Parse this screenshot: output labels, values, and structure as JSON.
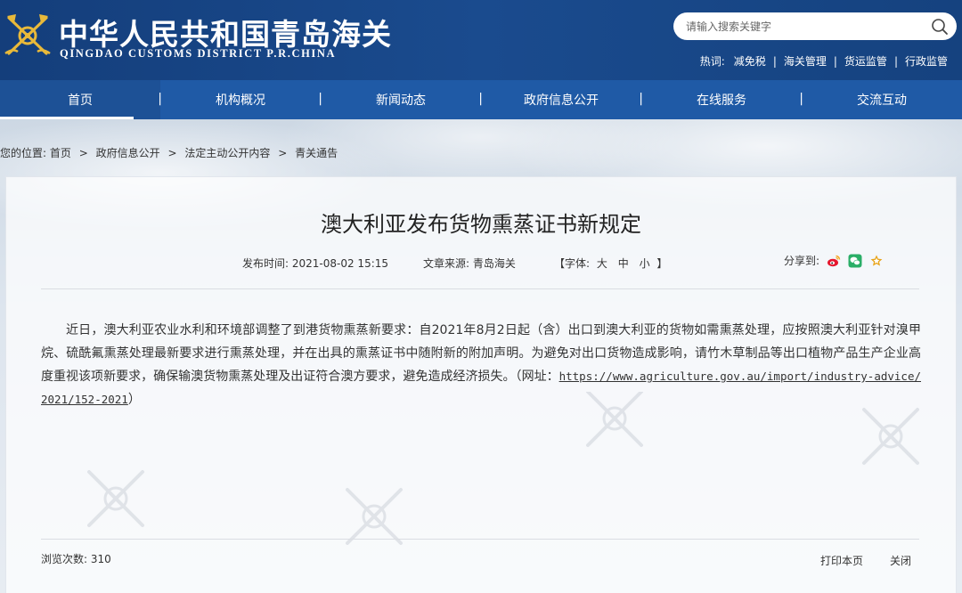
{
  "header": {
    "title": "中华人民共和国青岛海关",
    "subtitle": "QINGDAO CUSTOMS DISTRICT P.R.CHINA",
    "search_placeholder": "请输入搜索关键字",
    "hotwords_label": "热词:",
    "hotwords": [
      "减免税",
      "海关管理",
      "货运监管",
      "行政监管"
    ]
  },
  "nav": {
    "items": [
      "首页",
      "机构概况",
      "新闻动态",
      "政府信息公开",
      "在线服务",
      "交流互动"
    ],
    "separator": "|"
  },
  "breadcrumb": {
    "prefix": "您的位置:",
    "items": [
      "首页",
      "政府信息公开",
      "法定主动公开内容",
      "青关通告"
    ],
    "separator": ">"
  },
  "article": {
    "title": "澳大利亚发布货物熏蒸证书新规定",
    "date_label": "发布时间:",
    "date": "2021-08-02 15:15",
    "source_label": "文章来源:",
    "source": "青岛海关",
    "font_label_open": "【字体:",
    "font_sizes": [
      "大",
      "中",
      "小"
    ],
    "font_label_close": "】",
    "share_label": "分享到:",
    "body": "近日，澳大利亚农业水利和环境部调整了到港货物熏蒸新要求：自2021年8月2日起（含）出口到澳大利亚的货物如需熏蒸处理，应按照澳大利亚针对溴甲烷、硫酰氟熏蒸处理最新要求进行熏蒸处理，并在出具的熏蒸证书中随附新的附加声明。为避免对出口货物造成影响，请竹木草制品等出口植物产品生产企业高度重视该项新要求，确保输澳货物熏蒸处理及出证符合澳方要求，避免造成经济损失。（网址：",
    "body_link": "https://www.agriculture.gov.au/import/industry-advice/2021/152-2021",
    "body_end": "）",
    "views_label": "浏览次数:",
    "views": "310",
    "print_label": "打印本页",
    "close_label": "关闭"
  },
  "colors": {
    "header_bg": "#1a4b8e",
    "nav_bg": "#1f5aa6",
    "weibo_red": "#e6162d",
    "wechat_green": "#2aae67",
    "favorite_gold": "#e8a317"
  },
  "icons": [
    "customs-emblem-icon",
    "search-icon",
    "weibo-icon",
    "wechat-icon",
    "favorite-icon"
  ]
}
